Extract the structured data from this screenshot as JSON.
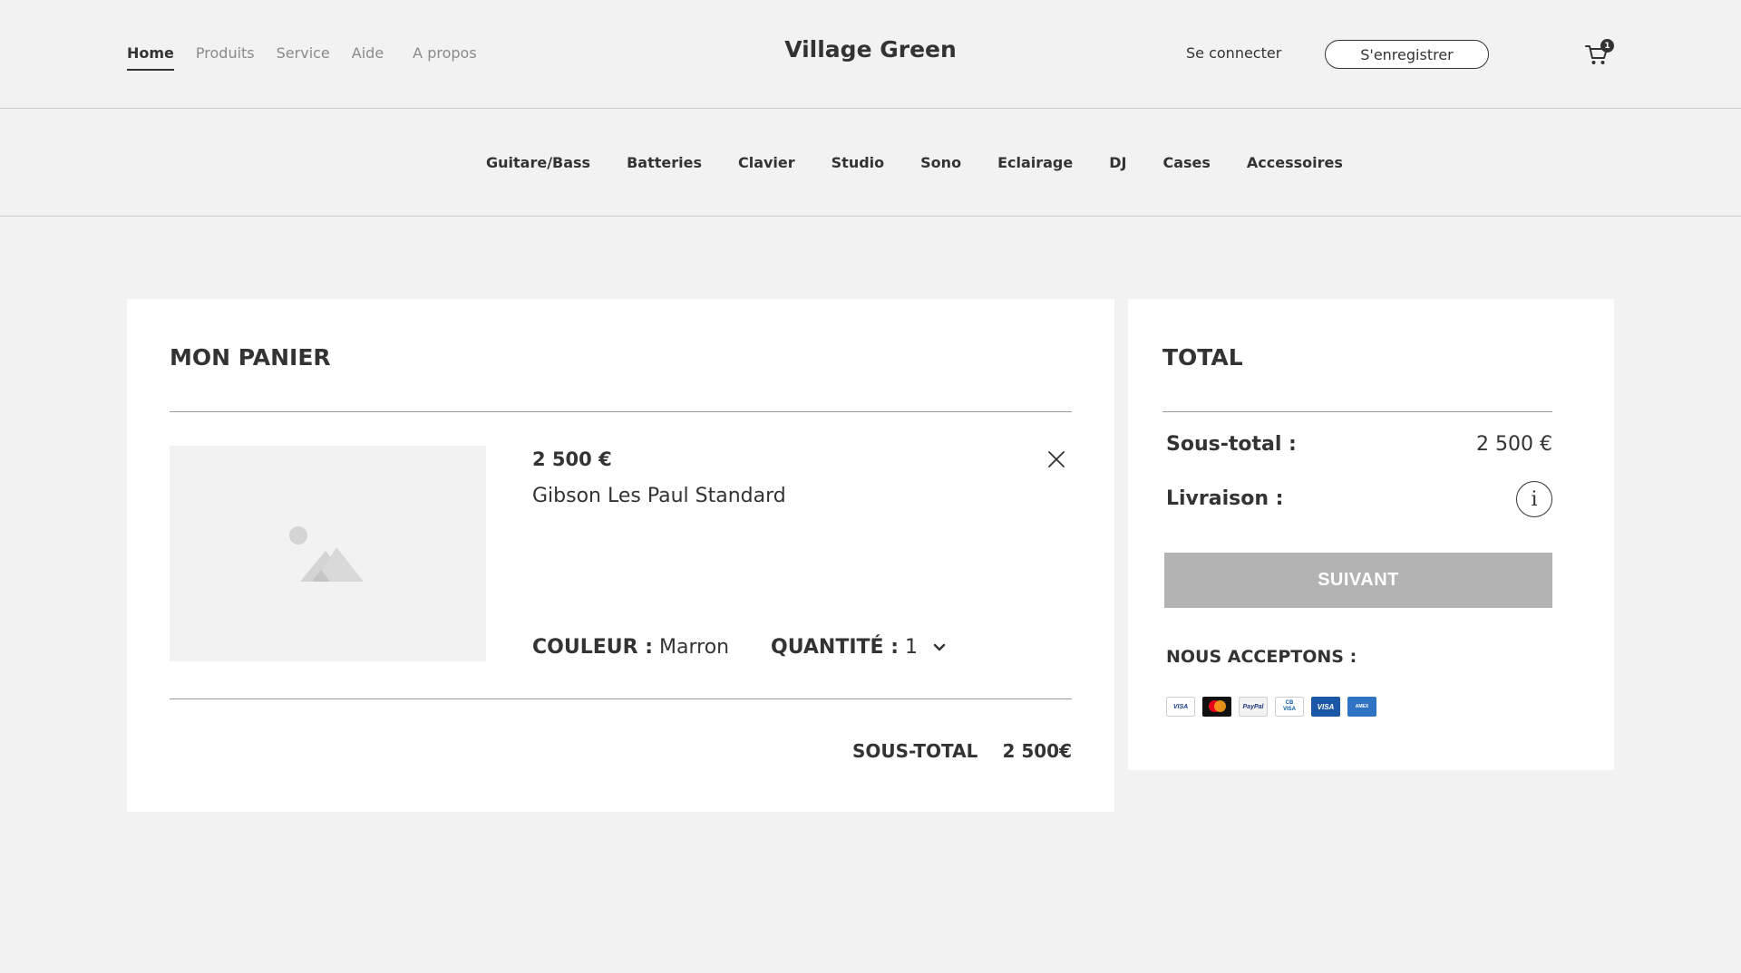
{
  "header": {
    "nav": [
      {
        "label": "Home",
        "active": true
      },
      {
        "label": "Produits",
        "active": false
      },
      {
        "label": "Service",
        "active": false
      },
      {
        "label": "Aide",
        "active": false
      },
      {
        "label": "A propos",
        "active": false
      }
    ],
    "brand": "Village Green",
    "login_label": "Se connecter",
    "register_label": "S'enregistrer",
    "cart_count": "1",
    "cart_icon": "shopping-cart-icon"
  },
  "categories": [
    "Guitare/Bass",
    "Batteries",
    "Clavier",
    "Studio",
    "Sono",
    "Eclairage",
    "DJ",
    "Cases",
    "Accessoires"
  ],
  "cart": {
    "title": "MON PANIER",
    "item": {
      "price": "2 500 €",
      "name": "Gibson Les Paul Standard",
      "image_icon": "image-placeholder-icon",
      "color_label": "COULEUR :",
      "color_value": "Marron",
      "quantity_label": "QUANTITÉ :",
      "quantity_value": "1"
    },
    "subtotal_label": "SOUS-TOTAL",
    "subtotal_value": "2 500€"
  },
  "total": {
    "title": "TOTAL",
    "subtotal_label": "Sous-total  :",
    "subtotal_value": "2 500 €",
    "shipping_label": "Livraison  :",
    "info_glyph": "i",
    "next_label": "SUIVANT",
    "accept_label": "NOUS ACCEPTONS :",
    "payment_methods": [
      "VISA",
      "Mastercard",
      "PayPal",
      "CB",
      "VISA",
      "AMEX"
    ]
  },
  "colors": {
    "background": "#f2f2f2",
    "panel": "#ffffff",
    "text": "#333333",
    "muted": "#8a8a8a",
    "button_disabled": "#b3b3b3"
  }
}
